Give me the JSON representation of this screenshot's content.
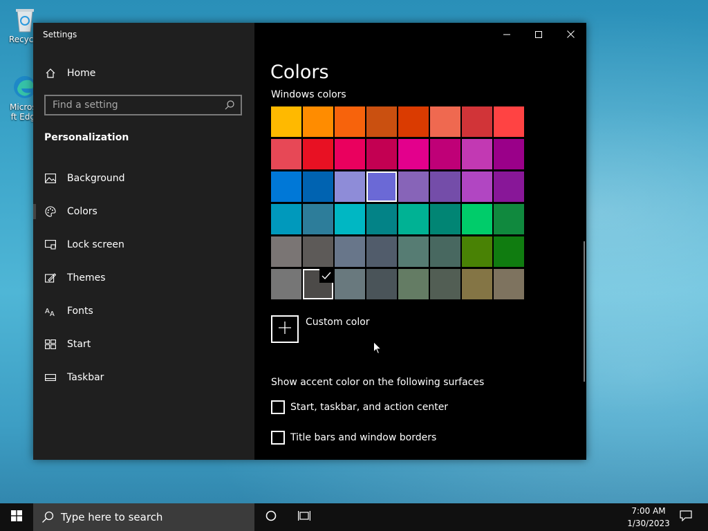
{
  "desktop": {
    "icons": [
      {
        "label": "Recycle"
      },
      {
        "label": "Microsoft Edge"
      }
    ]
  },
  "window": {
    "title": "Settings",
    "controls": {
      "minimize": "minimize-icon",
      "maximize": "maximize-icon",
      "close": "close-icon"
    }
  },
  "sidebar": {
    "home_label": "Home",
    "search_placeholder": "Find a setting",
    "section": "Personalization",
    "items": [
      {
        "label": "Background",
        "icon": "picture-icon"
      },
      {
        "label": "Colors",
        "icon": "palette-icon",
        "active": true
      },
      {
        "label": "Lock screen",
        "icon": "lock-screen-icon"
      },
      {
        "label": "Themes",
        "icon": "themes-icon"
      },
      {
        "label": "Fonts",
        "icon": "fonts-icon"
      },
      {
        "label": "Start",
        "icon": "start-icon"
      },
      {
        "label": "Taskbar",
        "icon": "taskbar-icon"
      }
    ]
  },
  "main": {
    "title": "Colors",
    "windows_colors_label": "Windows colors",
    "swatches": [
      [
        "#FFB900",
        "#FF8C00",
        "#F7630C",
        "#CA5010",
        "#DA3B01",
        "#EF6950",
        "#D13438",
        "#FF4343"
      ],
      [
        "#E74856",
        "#E81123",
        "#EA005E",
        "#C30052",
        "#E3008C",
        "#BF0077",
        "#C239B3",
        "#9A0089"
      ],
      [
        "#0078D7",
        "#0063B1",
        "#8E8CD8",
        "#6B69D6",
        "#8764B8",
        "#744DA9",
        "#B146C2",
        "#881798"
      ],
      [
        "#0099BC",
        "#2D7D9A",
        "#00B7C3",
        "#038387",
        "#00B294",
        "#018574",
        "#00CC6A",
        "#10893E"
      ],
      [
        "#7A7574",
        "#5D5A58",
        "#68768A",
        "#515C6B",
        "#567C73",
        "#486860",
        "#498205",
        "#107C10"
      ],
      [
        "#767676",
        "#4C4A48",
        "#69797E",
        "#4A5459",
        "#647C64",
        "#525E54",
        "#847545",
        "#7E735F"
      ]
    ],
    "selected_swatch": {
      "row": 2,
      "col": 3
    },
    "checked_swatch": {
      "row": 5,
      "col": 1
    },
    "custom_color_label": "Custom color",
    "surfaces_label": "Show accent color on the following surfaces",
    "checkboxes": [
      {
        "label": "Start, taskbar, and action center",
        "checked": false
      },
      {
        "label": "Title bars and window borders",
        "checked": false
      }
    ]
  },
  "taskbar": {
    "search_placeholder": "Type here to search",
    "time": "7:00 AM",
    "date": "1/30/2023"
  }
}
